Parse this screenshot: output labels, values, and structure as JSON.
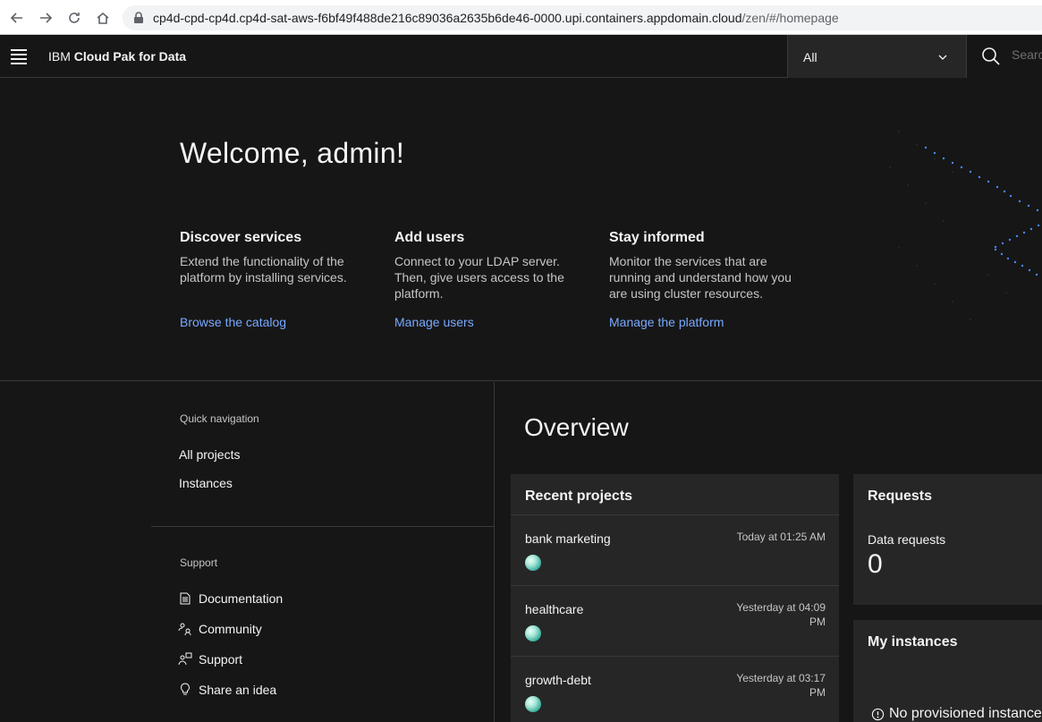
{
  "browser": {
    "url_host": "cp4d-cpd-cp4d.cp4d-sat-aws-f6bf49f488de216c89036a2635b6de46-0000.upi.containers.appdomain.cloud",
    "url_path": "/zen/#/homepage"
  },
  "header": {
    "brand_prefix": "IBM",
    "brand_name": "Cloud Pak for Data",
    "scope_value": "All",
    "search_placeholder": "Search"
  },
  "hero": {
    "welcome": "Welcome, admin!",
    "cards": [
      {
        "title": "Discover services",
        "description": "Extend the functionality of the platform by installing services.",
        "link": "Browse the catalog"
      },
      {
        "title": "Add users",
        "description": "Connect to your LDAP server. Then, give users access to the platform.",
        "link": "Manage users"
      },
      {
        "title": "Stay informed",
        "description": "Monitor the services that are running and understand how you are using cluster resources.",
        "link": "Manage the platform"
      }
    ]
  },
  "quick_nav": {
    "title": "Quick navigation",
    "items": [
      "All projects",
      "Instances"
    ]
  },
  "support": {
    "title": "Support",
    "items": [
      {
        "label": "Documentation",
        "icon": "document-icon"
      },
      {
        "label": "Community",
        "icon": "community-icon"
      },
      {
        "label": "Support",
        "icon": "support-icon"
      },
      {
        "label": "Share an idea",
        "icon": "lightbulb-icon"
      }
    ]
  },
  "overview": {
    "title": "Overview",
    "recent_projects": {
      "title": "Recent projects",
      "items": [
        {
          "name": "bank marketing",
          "date": "Today at 01:25 AM"
        },
        {
          "name": "healthcare",
          "date": "Yesterday at 04:09 PM"
        },
        {
          "name": "growth-debt",
          "date": "Yesterday at 03:17 PM"
        }
      ]
    },
    "requests": {
      "title": "Requests",
      "label": "Data requests",
      "value": "0"
    },
    "instances": {
      "title": "My instances",
      "empty": "No provisioned instances"
    }
  },
  "colors": {
    "background": "#161616",
    "tile": "#262626",
    "link": "#78a9ff"
  }
}
